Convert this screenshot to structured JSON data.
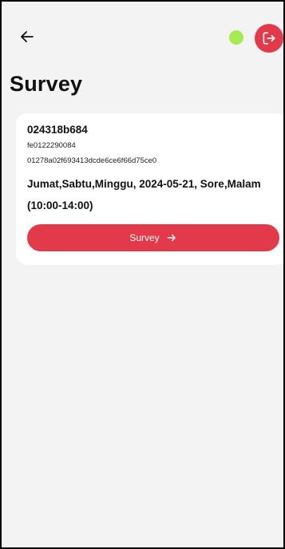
{
  "header": {
    "back_icon": "arrow-left-icon",
    "status_color": "#a4ec4f",
    "logout_icon": "logout-icon",
    "logout_color": "#e23a4a"
  },
  "page": {
    "title": "Survey"
  },
  "card": {
    "id": "024318b684",
    "code": "fe0122290084",
    "hash": "01278a02f693413dcde6ce6f66d75ce0",
    "schedule": "Jumat,Sabtu,Minggu, 2024-05-21, Sore,Malam (10:00-14:00)",
    "button_label": "Survey",
    "button_icon": "arrow-right-icon",
    "button_color": "#e23a4a"
  }
}
